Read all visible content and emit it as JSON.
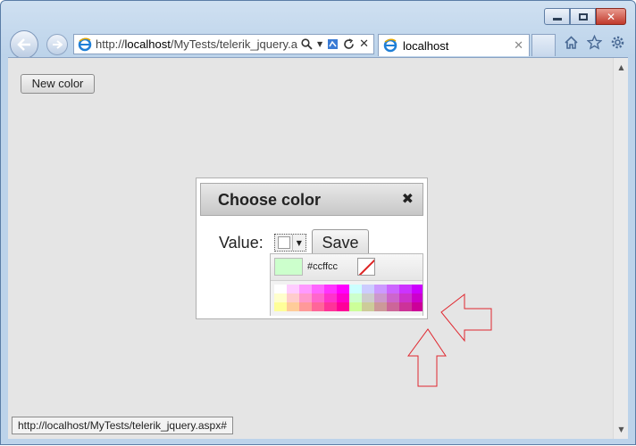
{
  "browser": {
    "address_url_plain": "http://",
    "address_url_bold": "localhost",
    "address_url_rest": "/MyTests/telerik_jquery.asp",
    "tab_title": "localhost",
    "status_url": "http://localhost/MyTests/telerik_jquery.aspx#"
  },
  "page": {
    "new_color_label": "New color"
  },
  "dialog": {
    "title": "Choose color",
    "close_glyph": "✖",
    "value_label": "Value:",
    "save_label": "Save"
  },
  "picker": {
    "selected_color": "#ffffff",
    "preview_color": "#ccffcc",
    "hex_label": "#ccffcc",
    "palette_rows": [
      [
        "#ffffff",
        "#ffccff",
        "#ff99ff",
        "#ff66ff",
        "#ff33ff",
        "#ff00ff",
        "#ccffff",
        "#ccccff",
        "#cc99ff",
        "#cc66ff",
        "#cc33ff",
        "#cc00ff"
      ],
      [
        "#ffffcc",
        "#ffcccc",
        "#ff99cc",
        "#ff66cc",
        "#ff33cc",
        "#ff00cc",
        "#ccffcc",
        "#cccccc",
        "#cc99cc",
        "#cc66cc",
        "#cc33cc",
        "#cc00cc"
      ],
      [
        "#ffff99",
        "#ffcc99",
        "#ff9999",
        "#ff6699",
        "#ff3399",
        "#ff0099",
        "#ccff99",
        "#cccc99",
        "#cc9999",
        "#cc6699",
        "#cc3399",
        "#cc0099"
      ]
    ]
  }
}
